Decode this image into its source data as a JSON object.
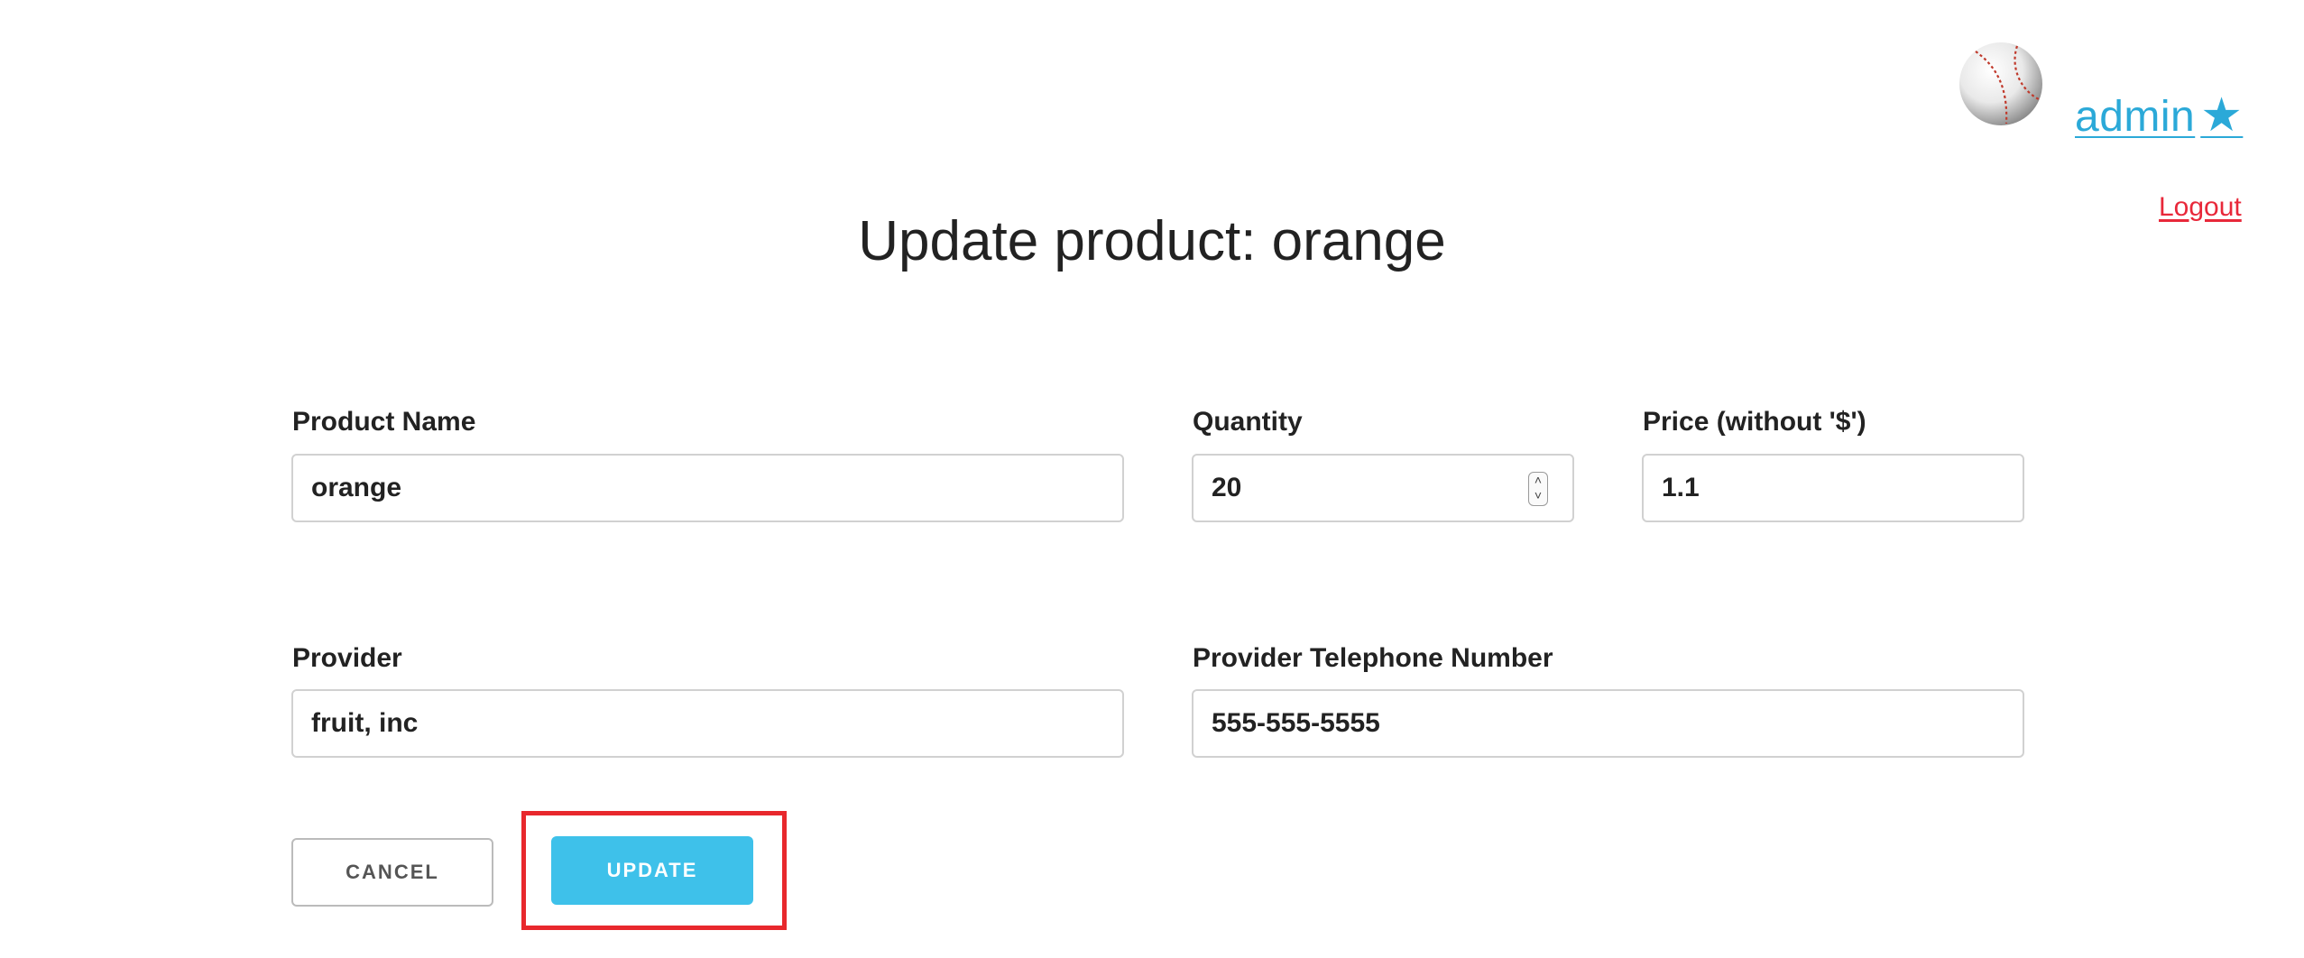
{
  "header": {
    "avatar_icon": "baseball-icon",
    "user_label": "admin",
    "user_star": "★",
    "logout_label": "Logout"
  },
  "page": {
    "title": "Update product: orange"
  },
  "form": {
    "product_name": {
      "label": "Product Name",
      "value": "orange"
    },
    "quantity": {
      "label": "Quantity",
      "value": "20"
    },
    "price": {
      "label": "Price (without '$')",
      "value": "1.1"
    },
    "provider": {
      "label": "Provider",
      "value": "fruit, inc"
    },
    "provider_phone": {
      "label": "Provider Telephone Number",
      "value": "555-555-5555"
    }
  },
  "actions": {
    "cancel_label": "CANCEL",
    "update_label": "UPDATE"
  },
  "colors": {
    "accent": "#3ec1ea",
    "link": "#2ba9d8",
    "logout": "#e8283a",
    "highlight": "#e8282d"
  }
}
